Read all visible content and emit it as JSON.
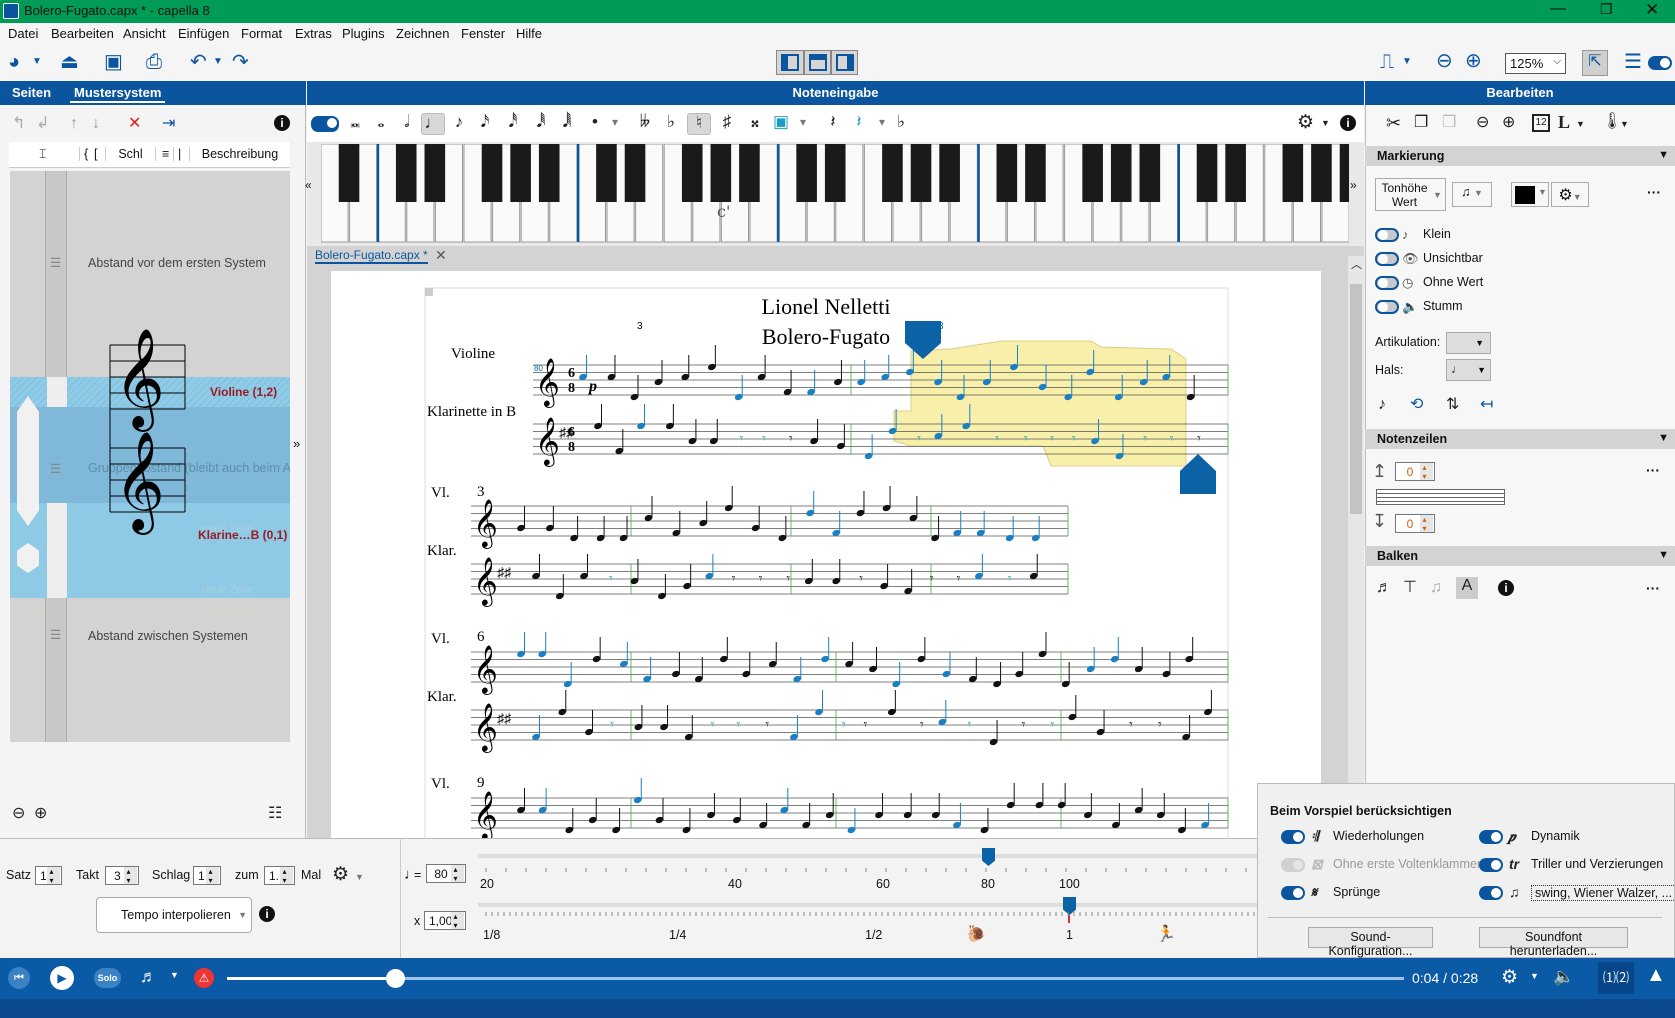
{
  "window": {
    "title": "Bolero-Fugato.capx * - capella 8"
  },
  "menu": [
    "Datei",
    "Bearbeiten",
    "Ansicht",
    "Einfügen",
    "Format",
    "Extras",
    "Plugins",
    "Zeichnen",
    "Fenster",
    "Hilfe"
  ],
  "toolbar": {
    "zoom": "125%"
  },
  "left_panel": {
    "tabs": [
      "Seiten",
      "Mustersystem"
    ],
    "columns": {
      "brace1": "{",
      "brace2": "[",
      "clef": "Schl",
      "lines": "≡",
      "bar": "|",
      "desc": "Beschreibung"
    },
    "rows": {
      "first_gap": "Abstand vor dem ersten System",
      "violin": "Violine (1,2)",
      "group_gap": "Gruppenabstand (bleibt auch beim Au",
      "new_line1": "neue Zeile",
      "clarinet": "Klarine…B (0,1)",
      "new_line2": "neue Zeile",
      "system_gap": "Abstand zwischen Systemen"
    }
  },
  "center": {
    "header": "Noteneingabe",
    "piano_label": "c'",
    "doc_tab": "Bolero-Fugato.capx *"
  },
  "score": {
    "composer": "Lionel Nelletti",
    "title": "Bolero-Fugato",
    "tempo_mark": "80",
    "time_sig": [
      "6",
      "8"
    ],
    "dynamic": "p",
    "instruments": [
      "Violine",
      "Klarinette in B"
    ],
    "short_names": [
      "Vl.",
      "Klar."
    ],
    "measure_numbers": [
      "3",
      "6",
      "9"
    ],
    "tuplet": "3"
  },
  "right_panel": {
    "header": "Bearbeiten",
    "marking": {
      "title": "Markierung",
      "mode": "Tonhöhe\nWert",
      "toggles": [
        {
          "label": "Klein",
          "on": false
        },
        {
          "label": "Unsichtbar",
          "on": false
        },
        {
          "label": "Ohne Wert",
          "on": false
        },
        {
          "label": "Stumm",
          "on": false
        }
      ],
      "articulation_label": "Artikulation:",
      "stem_label": "Hals:"
    },
    "staves": {
      "title": "Notenzeilen",
      "above": "0",
      "below": "0"
    },
    "beams": {
      "title": "Balken"
    }
  },
  "position": {
    "satz_label": "Satz",
    "satz": "1",
    "takt_label": "Takt",
    "takt": "3",
    "schlag_label": "Schlag",
    "schlag": "1",
    "zum_label": "zum",
    "zum": "1.",
    "mal_label": "Mal",
    "interpolate": "Tempo interpolieren"
  },
  "tempo": {
    "bpm": "80",
    "eq": "=",
    "factor_label": "x",
    "factor": "1,00",
    "bpm_ticks": [
      "20",
      "40",
      "60",
      "80",
      "100"
    ],
    "factor_ticks": [
      "1/8",
      "1/4",
      "1/2",
      "1"
    ]
  },
  "playback_options": {
    "title": "Beim Vorspiel berücksichtigen",
    "left": [
      {
        "label": "Wiederholungen",
        "on": true
      },
      {
        "label": "Ohne erste Voltenklammer",
        "on": false,
        "disabled": true
      },
      {
        "label": "Sprünge",
        "on": true
      }
    ],
    "right": [
      {
        "label": "Dynamik",
        "on": true
      },
      {
        "label": "Triller und Verzierungen",
        "on": true
      },
      {
        "label": "swing, Wiener Walzer, ...",
        "on": true
      }
    ],
    "sound_config": "Sound-Konfiguration...",
    "soundfont": "Soundfont herunterladen..."
  },
  "player": {
    "solo": "Solo",
    "time": "0:04 / 0:28",
    "progress": 0.143
  },
  "colors": {
    "accent": "#0b559f",
    "titlebar": "#009b55",
    "selection": "#f7efaa"
  }
}
